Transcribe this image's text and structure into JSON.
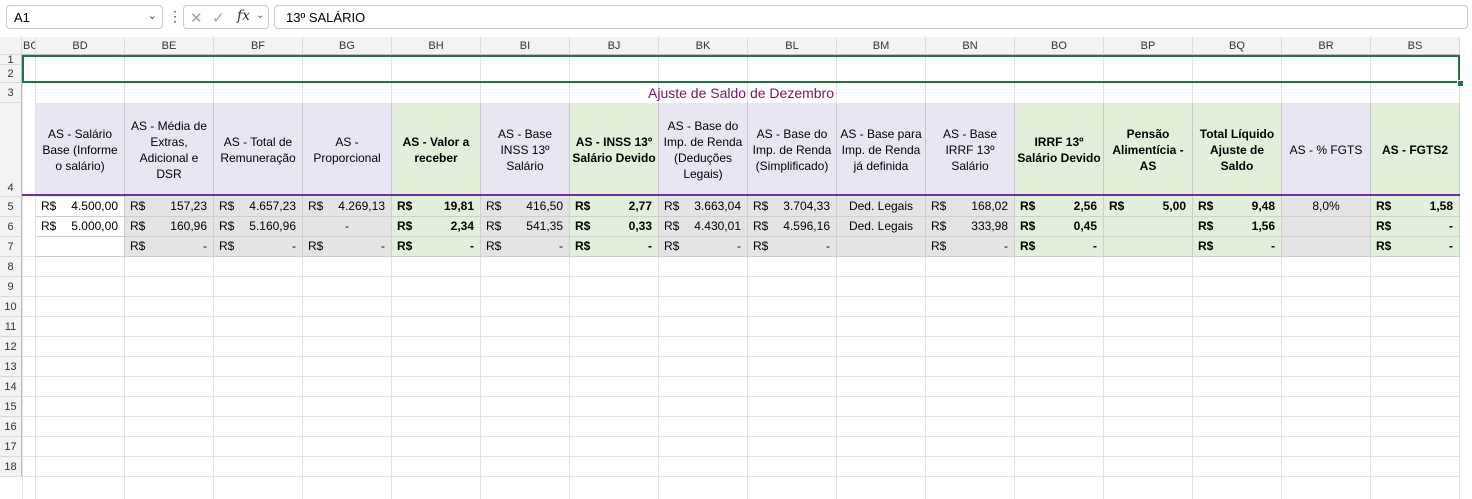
{
  "formula_bar": {
    "name_box": "A1",
    "formula": "13º SALÁRIO",
    "cancel_icon": "✕",
    "enter_icon": "✓",
    "fx_icon": "fx"
  },
  "columns": [
    "BC",
    "BD",
    "BE",
    "BF",
    "BG",
    "BH",
    "BI",
    "BJ",
    "BK",
    "BL",
    "BM",
    "BN",
    "BO",
    "BP",
    "BQ",
    "BR",
    "BS"
  ],
  "row_numbers": [
    "1",
    "2",
    "3",
    "4",
    "5",
    "6",
    "7",
    "8",
    "9",
    "10",
    "11",
    "12",
    "13",
    "14",
    "15",
    "16",
    "17",
    "18"
  ],
  "sheet": {
    "title": "Ajuste de Saldo de Dezembro",
    "headers": [
      "AS - Salário Base (Informe o salário)",
      "AS - Média de Extras, Adicional e DSR",
      "AS - Total de Remuneração",
      "AS - Proporcional",
      "AS - Valor a receber",
      "AS - Base INSS 13º Salário",
      "AS - INSS 13º Salário Devido",
      "AS - Base do Imp. de Renda (Deduções Legais)",
      "AS - Base do Imp. de Renda (Simplificado)",
      "AS - Base para Imp. de Renda já definida",
      "AS - Base IRRF 13º Salário",
      "IRRF 13º Salário Devido",
      "Pensão Alimentícia - AS",
      "Total Líquido Ajuste de Saldo",
      "AS - % FGTS",
      "AS - FGTS2"
    ],
    "rows": [
      {
        "BD": {
          "cur": "R$",
          "val": "4.500,00"
        },
        "BE": {
          "cur": "R$",
          "val": "157,23"
        },
        "BF": {
          "cur": "R$",
          "val": "4.657,23"
        },
        "BG": {
          "cur": "R$",
          "val": "4.269,13"
        },
        "BH": {
          "cur": "R$",
          "val": "19,81"
        },
        "BI": {
          "cur": "R$",
          "val": "416,50"
        },
        "BJ": {
          "cur": "R$",
          "val": "2,77"
        },
        "BK": {
          "cur": "R$",
          "val": "3.663,04"
        },
        "BL": {
          "cur": "R$",
          "val": "3.704,33"
        },
        "BM": "Ded. Legais",
        "BN": {
          "cur": "R$",
          "val": "168,02"
        },
        "BO": {
          "cur": "R$",
          "val": "2,56"
        },
        "BP": {
          "cur": "R$",
          "val": "5,00"
        },
        "BQ": {
          "cur": "R$",
          "val": "9,48"
        },
        "BR": "8,0%",
        "BS": {
          "cur": "R$",
          "val": "1,58"
        }
      },
      {
        "BD": {
          "cur": "R$",
          "val": "5.000,00"
        },
        "BE": {
          "cur": "R$",
          "val": "160,96"
        },
        "BF": {
          "cur": "R$",
          "val": "5.160,96"
        },
        "BG": "-",
        "BH": {
          "cur": "R$",
          "val": "2,34"
        },
        "BI": {
          "cur": "R$",
          "val": "541,35"
        },
        "BJ": {
          "cur": "R$",
          "val": "0,33"
        },
        "BK": {
          "cur": "R$",
          "val": "4.430,01"
        },
        "BL": {
          "cur": "R$",
          "val": "4.596,16"
        },
        "BM": "Ded. Legais",
        "BN": {
          "cur": "R$",
          "val": "333,98"
        },
        "BO": {
          "cur": "R$",
          "val": "0,45"
        },
        "BP": "",
        "BQ": {
          "cur": "R$",
          "val": "1,56"
        },
        "BR": "",
        "BS": {
          "cur": "R$",
          "val": "-"
        }
      },
      {
        "BD": "",
        "BE": {
          "cur": "R$",
          "val": "-"
        },
        "BF": {
          "cur": "R$",
          "val": "-"
        },
        "BG": {
          "cur": "R$",
          "val": "-"
        },
        "BH": {
          "cur": "R$",
          "val": "-"
        },
        "BI": {
          "cur": "R$",
          "val": "-"
        },
        "BJ": {
          "cur": "R$",
          "val": "-"
        },
        "BK": {
          "cur": "R$",
          "val": "-"
        },
        "BL": {
          "cur": "R$",
          "val": "-"
        },
        "BM": "",
        "BN": {
          "cur": "R$",
          "val": "-"
        },
        "BO": {
          "cur": "R$",
          "val": "-"
        },
        "BP": "",
        "BQ": {
          "cur": "R$",
          "val": "-"
        },
        "BR": "",
        "BS": {
          "cur": "R$",
          "val": "-"
        }
      }
    ]
  },
  "colors": {
    "header_purple": "#e8e6f3",
    "header_green": "#e2efda",
    "data_gray": "#e4e4e4",
    "title_text": "#7a1466",
    "selection_green": "#217346",
    "divider_purple": "#7030a0"
  }
}
